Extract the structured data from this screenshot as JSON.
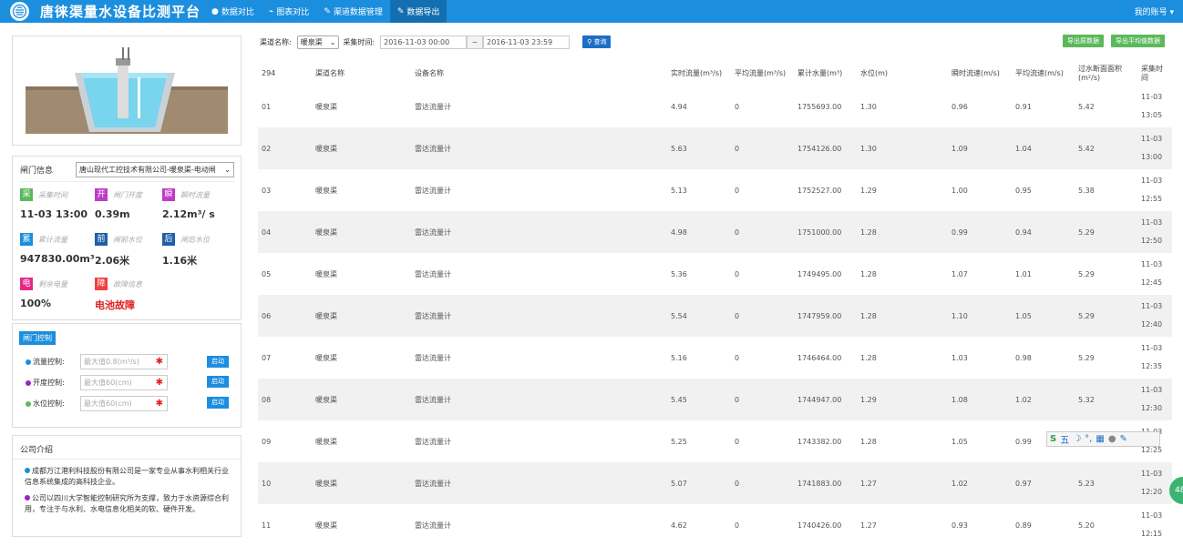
{
  "header": {
    "title": "唐徕渠量水设备比测平台",
    "nav": [
      {
        "label": "数据对比",
        "icon": "apple-icon"
      },
      {
        "label": "图表对比",
        "icon": "chart-icon"
      },
      {
        "label": "渠道数据管理",
        "icon": "wrench-icon"
      },
      {
        "label": "数据导出",
        "icon": "wrench-icon"
      }
    ],
    "active_nav": "数据导出",
    "account": "我的账号"
  },
  "gate_info": {
    "label": "闸门信息",
    "select_value": "唐山现代工控技术有限公司-暖泉渠-电动闸",
    "metrics": [
      {
        "badge": "采",
        "label": "采集时间",
        "value": "11-03 13:00",
        "color": "#5cb85c"
      },
      {
        "badge": "开",
        "label": "闸门开度",
        "value": "0.39m",
        "color": "#c03cc8"
      },
      {
        "badge": "瞬",
        "label": "瞬时流量",
        "value": "2.12m³/ s",
        "color": "#c03cc8"
      },
      {
        "badge": "累",
        "label": "累计流量",
        "value": "947830.00m³",
        "color": "#1c8ede"
      },
      {
        "badge": "前",
        "label": "闸前水位",
        "value": "2.06米",
        "color": "#1f5fa8"
      },
      {
        "badge": "后",
        "label": "闸后水位",
        "value": "1.16米",
        "color": "#1f5fa8"
      },
      {
        "badge": "电",
        "label": "剩余电量",
        "value": "100%",
        "color": "#e8278a"
      },
      {
        "badge": "障",
        "label": "故障信息",
        "value": "电池故障",
        "color": "#f04040"
      }
    ]
  },
  "control": {
    "title": "闸门控制",
    "rows": [
      {
        "label": "流量控制:",
        "placeholder": "最大值0.8(m³/s)",
        "button": "启动",
        "dot": "#1c8ede"
      },
      {
        "label": "开度控制:",
        "placeholder": "最大值60(cm)",
        "button": "启动",
        "dot": "#a020c8"
      },
      {
        "label": "水位控制:",
        "placeholder": "最大值60(cm)",
        "button": "启动",
        "dot": "#5cb85c"
      }
    ]
  },
  "company": {
    "title": "公司介绍",
    "paragraphs": [
      {
        "text": "成都万江港利科技股份有限公司是一家专业从事水利相关行业信息系统集成的高科技企业。",
        "dot": "#1c8ede"
      },
      {
        "text": "公司以四川大学智能控制研究所为支撑，致力于水资源综合利用，专注于与水利、水电信息化相关的软、硬件开发。",
        "dot": "#a020c8"
      }
    ]
  },
  "filter": {
    "channel_label": "渠道名称:",
    "channel_value": "暖泉渠",
    "time_label": "采集时间:",
    "start": "2016-11-03 00:00",
    "sep": "~",
    "end": "2016-11-03 23:59",
    "query": "查询",
    "export_raw": "导出原数据",
    "export_avg": "导出平均值数据"
  },
  "table": {
    "headers": [
      "294",
      "渠道名称",
      "设备名称",
      "实时流量(m³/s)",
      "平均流量(m³/s)",
      "累计水量(m³)",
      "水位(m)",
      "瞬时流速(m/s)",
      "平均流速(m/s)",
      "过水断面面积(m²/s)",
      "采集时间"
    ],
    "rows": [
      [
        "01",
        "暖泉渠",
        "雷达流量计",
        "4.94",
        "0",
        "1755693.00",
        "1.30",
        "0.96",
        "0.91",
        "5.42",
        "11-03",
        "13:05"
      ],
      [
        "02",
        "暖泉渠",
        "雷达流量计",
        "5.63",
        "0",
        "1754126.00",
        "1.30",
        "1.09",
        "1.04",
        "5.42",
        "11-03",
        "13:00"
      ],
      [
        "03",
        "暖泉渠",
        "雷达流量计",
        "5.13",
        "0",
        "1752527.00",
        "1.29",
        "1.00",
        "0.95",
        "5.38",
        "11-03",
        "12:55"
      ],
      [
        "04",
        "暖泉渠",
        "雷达流量计",
        "4.98",
        "0",
        "1751000.00",
        "1.28",
        "0.99",
        "0.94",
        "5.29",
        "11-03",
        "12:50"
      ],
      [
        "05",
        "暖泉渠",
        "雷达流量计",
        "5.36",
        "0",
        "1749495.00",
        "1.28",
        "1.07",
        "1.01",
        "5.29",
        "11-03",
        "12:45"
      ],
      [
        "06",
        "暖泉渠",
        "雷达流量计",
        "5.54",
        "0",
        "1747959.00",
        "1.28",
        "1.10",
        "1.05",
        "5.29",
        "11-03",
        "12:40"
      ],
      [
        "07",
        "暖泉渠",
        "雷达流量计",
        "5.16",
        "0",
        "1746464.00",
        "1.28",
        "1.03",
        "0.98",
        "5.29",
        "11-03",
        "12:35"
      ],
      [
        "08",
        "暖泉渠",
        "雷达流量计",
        "5.45",
        "0",
        "1744947.00",
        "1.29",
        "1.08",
        "1.02",
        "5.32",
        "11-03",
        "12:30"
      ],
      [
        "09",
        "暖泉渠",
        "雷达流量计",
        "5.25",
        "0",
        "1743382.00",
        "1.28",
        "1.05",
        "0.99",
        "",
        "11-03",
        "12:25"
      ],
      [
        "10",
        "暖泉渠",
        "雷达流量计",
        "5.07",
        "0",
        "1741883.00",
        "1.27",
        "1.02",
        "0.97",
        "5.23",
        "11-03",
        "12:20"
      ],
      [
        "11",
        "暖泉渠",
        "雷达流量计",
        "4.62",
        "0",
        "1740426.00",
        "1.27",
        "0.93",
        "0.89",
        "5.20",
        "11-03",
        "12:15"
      ]
    ]
  },
  "ime": {
    "label": "五"
  },
  "fab": {
    "label": "48"
  }
}
